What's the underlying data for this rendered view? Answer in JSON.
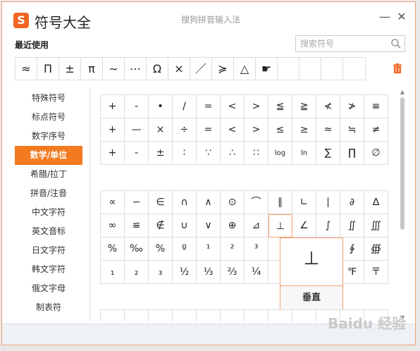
{
  "window": {
    "logo_letter": "S",
    "title": "符号大全",
    "subtitle": "搜狗拼音输入法",
    "minimize_glyph": "—",
    "close_glyph": "✕"
  },
  "recent": {
    "label": "最近使用",
    "symbols": [
      "≈",
      "Π",
      "±",
      "π",
      "∼",
      "⋯",
      "Ω",
      "×",
      "／",
      "≽",
      "△",
      "☛",
      "",
      "",
      "",
      ""
    ]
  },
  "search": {
    "placeholder": "搜索符号"
  },
  "sidebar": {
    "items": [
      "特殊符号",
      "标点符号",
      "数字序号",
      "数学/单位",
      "希腊/拉丁",
      "拼音/注音",
      "中文字符",
      "英文音标",
      "日文字符",
      "韩文字符",
      "俄文字母",
      "制表符"
    ],
    "active_index": 3
  },
  "grid_top": [
    [
      "+",
      "-",
      "•",
      "/",
      "=",
      "<",
      ">",
      "≦",
      "≧",
      "≮",
      "≯",
      "≡"
    ],
    [
      "+",
      "—",
      "×",
      "÷",
      "=",
      "<",
      ">",
      "≤",
      "≥",
      "≈",
      "≒",
      "≠"
    ],
    [
      "+",
      "-",
      "±",
      "∶",
      "∵",
      "∴",
      "∷",
      "log",
      "ln",
      "∑",
      "∏",
      "∅"
    ]
  ],
  "grid_mid": [
    [
      "∝",
      "∽",
      "∈",
      "∩",
      "∧",
      "⊙",
      "⌒",
      "∥",
      "∟",
      "∣",
      "∂",
      "∆"
    ],
    [
      "∞",
      "≌",
      "∉",
      "∪",
      "∨",
      "⊕",
      "⊿",
      "⊥",
      "∠",
      "∫",
      "∬",
      "∭"
    ],
    [
      "%",
      "‰",
      "%",
      "º",
      "¹",
      "²",
      "³",
      "",
      "",
      "",
      "∲",
      "∰"
    ],
    [
      "₁",
      "₂",
      "₃",
      "½",
      "⅓",
      "⅔",
      "¼",
      "",
      "",
      "",
      "℉",
      "〒"
    ]
  ],
  "grid_bottom": [
    [
      "",
      "",
      "",
      "",
      "",
      "",
      "",
      "",
      "",
      "",
      "",
      ""
    ]
  ],
  "popup": {
    "symbol": "⊥",
    "label": "垂直"
  },
  "watermark": "Baidu 经验",
  "colors": {
    "accent": "#f47a20",
    "border": "#f0a070"
  }
}
